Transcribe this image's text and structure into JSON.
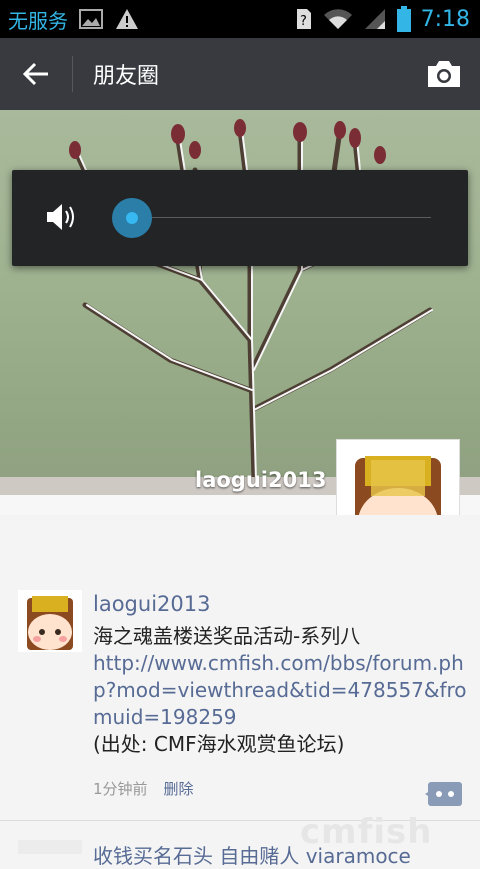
{
  "status": {
    "carrier": "无服务",
    "time": "7:18"
  },
  "appbar": {
    "title": "朋友圈"
  },
  "cover": {
    "name": "laogui2013"
  },
  "volume": {
    "level": 0.0
  },
  "post": {
    "user": "laogui2013",
    "line1": "海之魂盖楼送奖品活动-系列八",
    "link": "http://www.cmfish.com/bbs/forum.php?mod=viewthread&tid=478557&fromuid=198259",
    "line3": "(出处: CMF海水观赏鱼论坛)",
    "time": "1分钟前",
    "delete": "删除"
  },
  "next": {
    "text": "收钱买名石头 自由赌人 viaramoce"
  },
  "watermark": "cmfish"
}
